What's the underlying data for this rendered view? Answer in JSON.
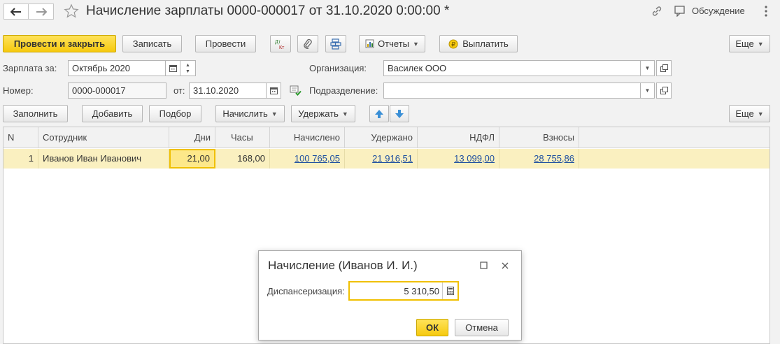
{
  "window": {
    "title": "Начисление зарплаты 0000-000017 от 31.10.2020 0:00:00 *",
    "discussion_label": "Обсуждение"
  },
  "toolbar": {
    "post_and_close": "Провести и закрыть",
    "save": "Записать",
    "post": "Провести",
    "dt_kt_top": "Дт",
    "dt_kt_bottom": "Кт",
    "reports": "Отчеты",
    "pay": "Выплатить",
    "more": "Еще"
  },
  "form": {
    "salary_for_label": "Зарплата за:",
    "salary_for_value": "Октябрь 2020",
    "organization_label": "Организация:",
    "organization_value": "Василек ООО",
    "number_label": "Номер:",
    "number_value": "0000-000017",
    "date_label": "от:",
    "date_value": "31.10.2020",
    "department_label": "Подразделение:",
    "department_value": ""
  },
  "table_toolbar": {
    "fill": "Заполнить",
    "add": "Добавить",
    "select": "Подбор",
    "accrue": "Начислить",
    "withhold": "Удержать",
    "more": "Еще"
  },
  "table": {
    "columns": [
      "N",
      "Сотрудник",
      "Дни",
      "Часы",
      "Начислено",
      "Удержано",
      "НДФЛ",
      "Взносы"
    ],
    "rows": [
      {
        "n": "1",
        "employee": "Иванов Иван Иванович",
        "days": "21,00",
        "hours": "168,00",
        "accrued": "100 765,05",
        "withheld": "21 916,51",
        "ndfl": "13 099,00",
        "contributions": "28 755,86"
      }
    ]
  },
  "modal": {
    "title": "Начисление (Иванов И. И.)",
    "field_label": "Диспансеризация:",
    "field_value": "5 310,50",
    "ok": "ОК",
    "cancel": "Отмена"
  },
  "colors": {
    "accent_yellow": "#f6c90e",
    "row_highlight": "#faf0c0",
    "link_blue": "#1f4fa0",
    "arrow_blue": "#3a8fd6"
  }
}
